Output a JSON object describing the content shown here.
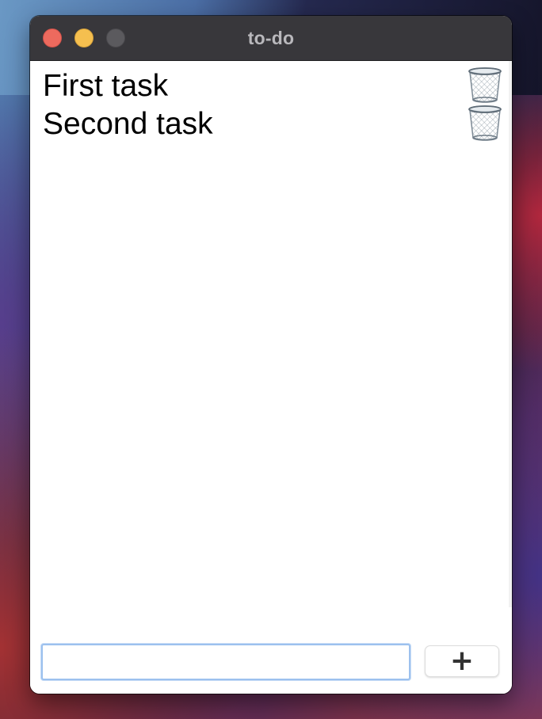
{
  "window": {
    "title": "to-do"
  },
  "tasks": [
    {
      "label": "First task",
      "delete_icon": "trash-can-icon"
    },
    {
      "label": "Second task",
      "delete_icon": "trash-can-icon"
    }
  ],
  "new_task": {
    "value": "",
    "placeholder": ""
  },
  "add_button": {
    "label": "+"
  },
  "colors": {
    "close": "#ed6a5e",
    "minimize": "#f5bf4f",
    "zoom_disabled": "#5b5a5e",
    "titlebar": "#38373b",
    "input_focus_ring": "#9cc1ee"
  }
}
